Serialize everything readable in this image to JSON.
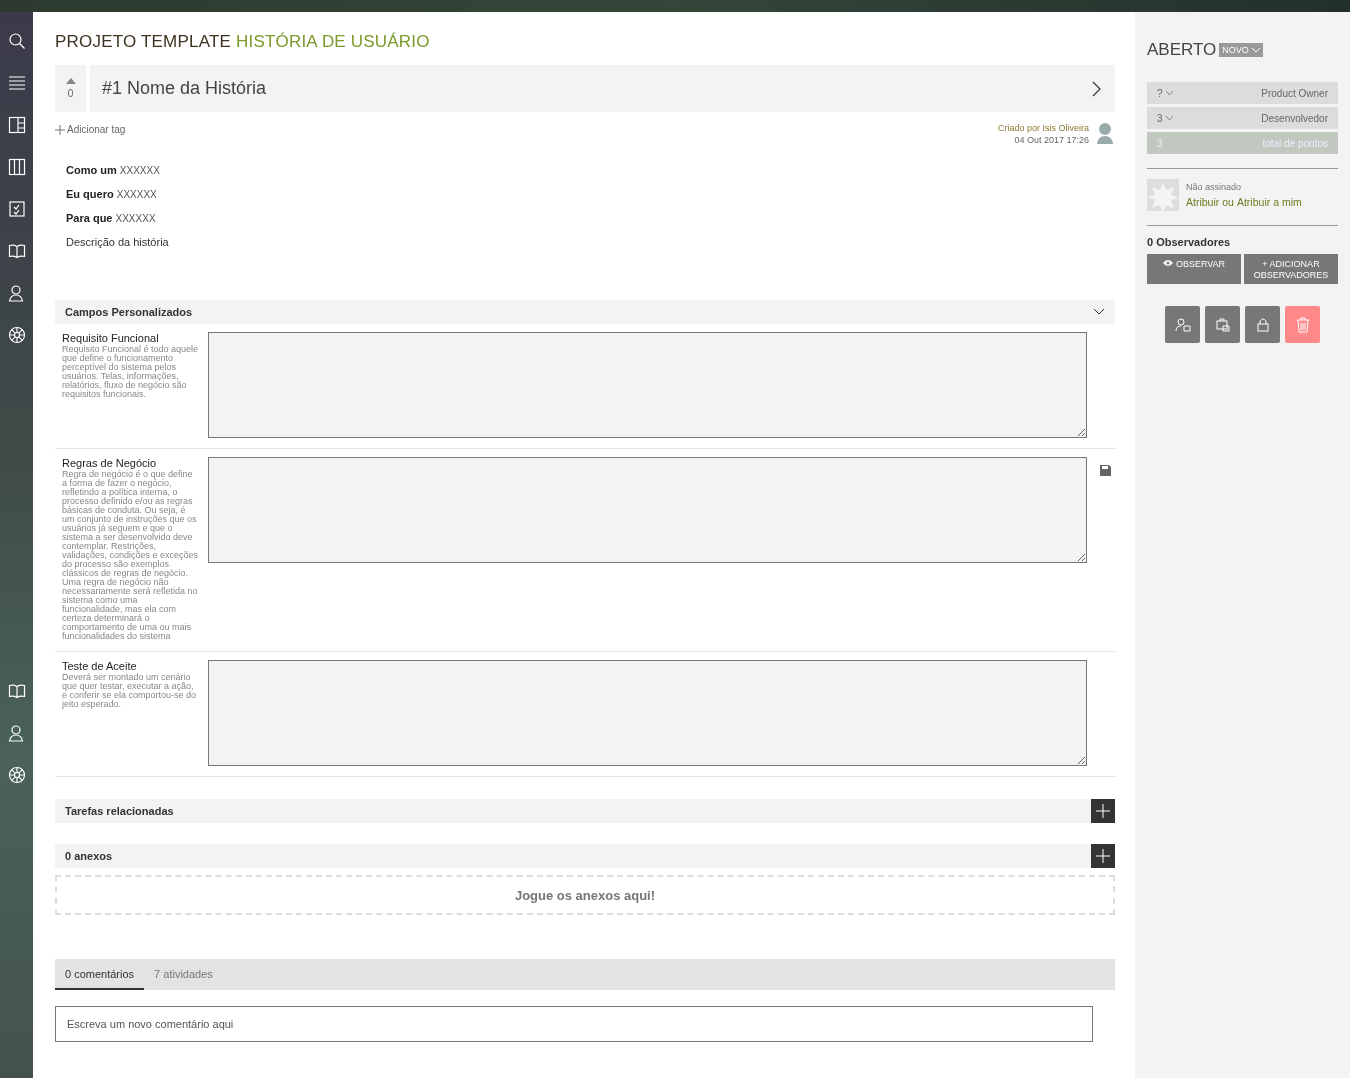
{
  "header": {
    "project": "PROJETO TEMPLATE",
    "type": "HISTÓRIA DE USUÁRIO"
  },
  "story": {
    "votes": "0",
    "ref": "#1",
    "title": "Nome da História"
  },
  "add_tag": "Adicionar tag",
  "created": {
    "by": "Criado por Isis Oliveira",
    "date": "04 Out 2017 17:26"
  },
  "description": {
    "lines": [
      {
        "label": "Como um",
        "value": "XXXXXX"
      },
      {
        "label": "Eu quero",
        "value": "XXXXXX"
      },
      {
        "label": "Para que",
        "value": "XXXXXX"
      }
    ],
    "text": "Descrição da história"
  },
  "custom_fields": {
    "title": "Campos Personalizados",
    "expanded": true,
    "fields": [
      {
        "name": "Requisito Funcional",
        "description": "Requisito Funcional é todo aquele que define o funcionamento perceptível do sistema pelos usuários. Telas, informações, relatórios, fluxo de negócio são requisitos funcionais.",
        "unsaved": false
      },
      {
        "name": "Regras de Negócio",
        "description": "Regra de negócio é o que define a forma de fazer o negócio, refletindo a política interna, o processo definido e/ou as regras básicas de conduta. Ou seja, é um conjunto de instruções que os usuários já seguem e que o sistema a ser desenvolvido deve contemplar. Restrições, validações, condições e exceções do processo são exemplos clássicos de regras de negócio. Uma regra de negócio não necessariamente será refletida no sistema como uma funcionalidade, mas ela com certeza determinará o comportamento de uma ou mais funcionalidades do sistema",
        "unsaved": true
      },
      {
        "name": "Teste de Aceite",
        "description": "Deverá ser montado um cenário que quer testar, executar a ação, e conferir se ela comportou-se do jeito esperado.",
        "unsaved": false
      }
    ]
  },
  "tasks": {
    "title": "Tarefas relacionadas"
  },
  "attachments": {
    "title": "0 anexos",
    "dropzone": "Jogue os anexos aqui!"
  },
  "tabs": [
    {
      "label": "0 comentários",
      "selected": true
    },
    {
      "label": "7 atividades",
      "selected": false
    }
  ],
  "comment": {
    "placeholder": "Escreva um novo comentário aqui"
  },
  "status": {
    "label": "ABERTO",
    "badge": "NOVO"
  },
  "points": [
    {
      "kind": "role",
      "value": "?",
      "role": "Product Owner"
    },
    {
      "kind": "role",
      "value": "3",
      "role": "Desenvolvedor"
    },
    {
      "kind": "total",
      "value": "3",
      "role": "total de pontos"
    }
  ],
  "assignee": {
    "status": "Não assinado",
    "assign": "Atribuir",
    "separator": "ou",
    "assign_me": "Atribuir a mim"
  },
  "watchers": {
    "count": "0 Observadores",
    "watch": "OBSERVAR",
    "add": "+ ADICIONAR OBSERVADORES"
  },
  "actions": [
    {
      "kind": "assign"
    },
    {
      "kind": "clone"
    },
    {
      "kind": "lock"
    },
    {
      "kind": "delete"
    }
  ]
}
